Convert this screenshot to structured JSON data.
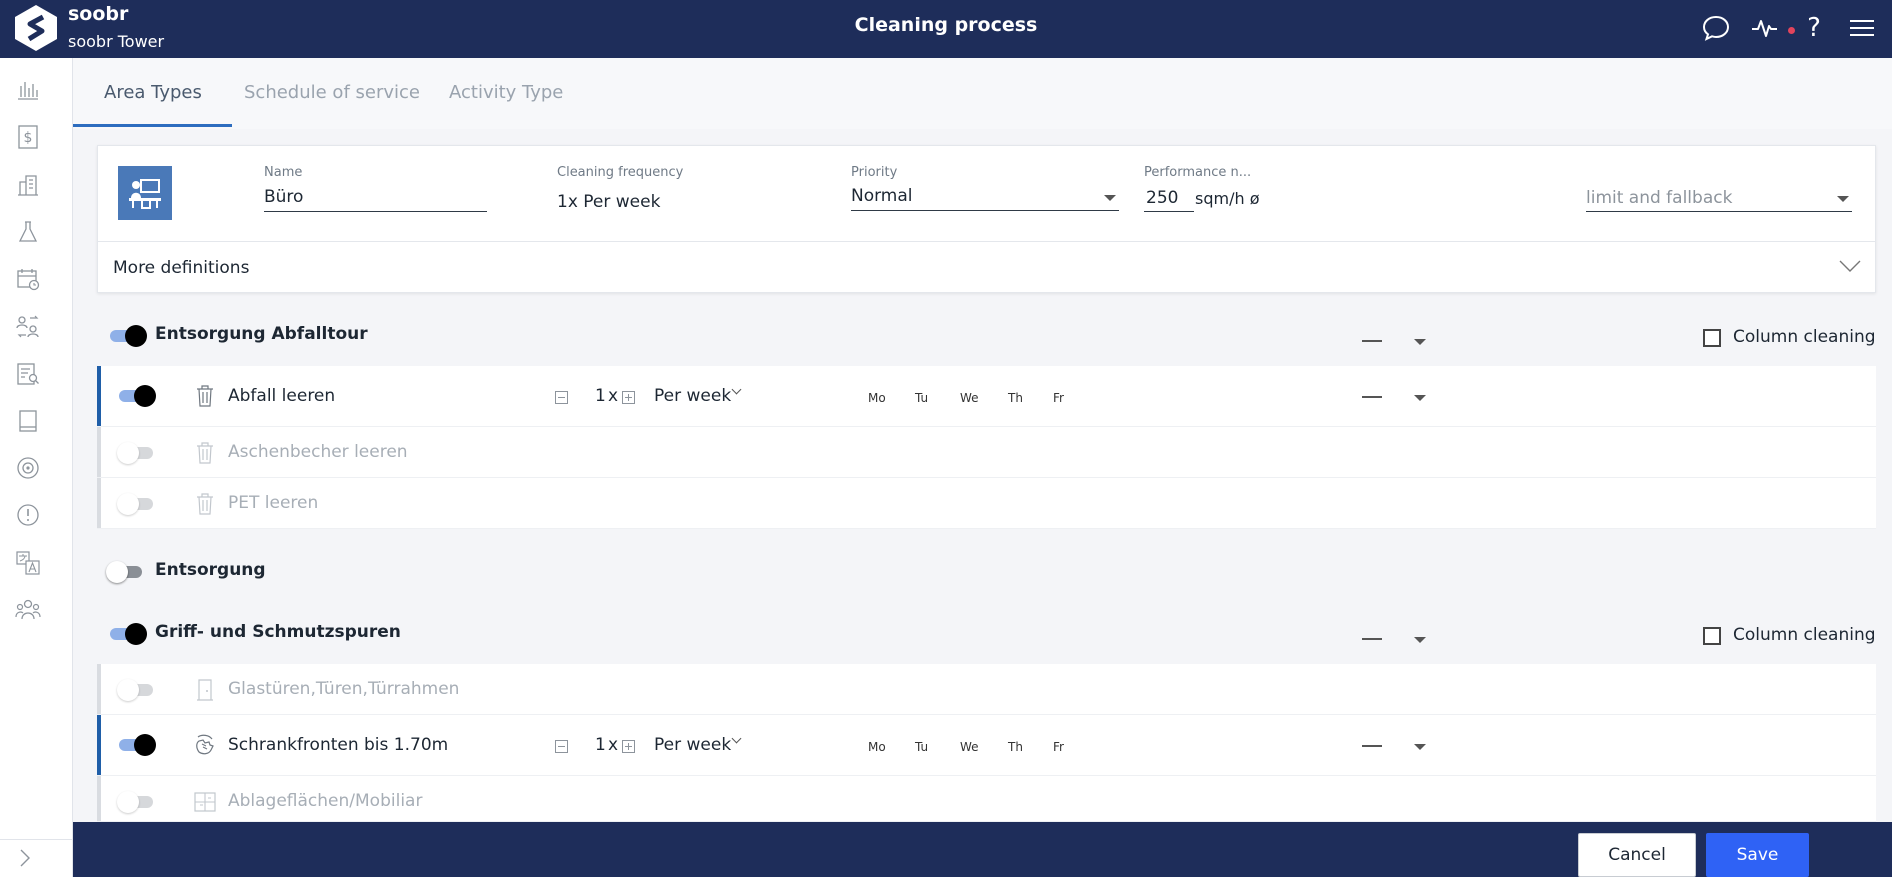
{
  "header": {
    "brand_name": "soobr",
    "site_name": "soobr Tower",
    "page_title": "Cleaning process",
    "icons": [
      "chat-icon",
      "activity-icon",
      "help-icon",
      "menu-icon"
    ],
    "help_glyph": "?"
  },
  "sidebar": {
    "items": [
      "bar-chart-icon",
      "dollar-icon",
      "building-icon",
      "flask-icon",
      "calendar-clock-icon",
      "swap-users-icon",
      "checklist-search-icon",
      "book-icon",
      "target-icon",
      "alert-icon",
      "translate-icon",
      "team-icon"
    ],
    "expand_icon": "chevron-right-icon"
  },
  "tabs": [
    {
      "label": "Area Types",
      "active": true
    },
    {
      "label": "Schedule of service",
      "active": false
    },
    {
      "label": "Activity Type",
      "active": false
    }
  ],
  "area": {
    "icon": "office-desk-icon",
    "name_label": "Name",
    "name_value": "Büro",
    "frequency_label": "Cleaning frequency",
    "frequency_value": "1x Per week",
    "priority_label": "Priority",
    "priority_value": "Normal",
    "performance_label": "Performance n...",
    "performance_value": "250",
    "performance_unit": "sqm/h ø",
    "limit_placeholder": "limit and fallback",
    "more_definitions": "More definitions"
  },
  "groups": [
    {
      "title": "Entsorgung Abfalltour",
      "enabled": true,
      "show_column_cleaning": true,
      "column_cleaning_label": "Column cleaning",
      "activities": [
        {
          "label": "Abfall leeren",
          "enabled": true,
          "icon": "trash-icon",
          "count": "1",
          "count_suffix": "x",
          "frequency": "Per week",
          "days": [
            "Mo",
            "Tu",
            "We",
            "Th",
            "Fr"
          ]
        },
        {
          "label": "Aschenbecher leeren",
          "enabled": false,
          "icon": "trash-icon"
        },
        {
          "label": "PET leeren",
          "enabled": false,
          "icon": "trash-icon"
        }
      ]
    },
    {
      "title": "Entsorgung",
      "enabled": false,
      "show_column_cleaning": false,
      "activities": []
    },
    {
      "title": "Griff- und Schmutzspuren",
      "enabled": true,
      "show_column_cleaning": true,
      "column_cleaning_label": "Column cleaning",
      "activities": [
        {
          "label": "Glastüren,Türen,Türrahmen",
          "enabled": false,
          "icon": "door-icon"
        },
        {
          "label": "Schrankfronten bis 1.70m",
          "enabled": true,
          "icon": "hand-wipe-icon",
          "count": "1",
          "count_suffix": "x",
          "frequency": "Per week",
          "days": [
            "Mo",
            "Tu",
            "We",
            "Th",
            "Fr"
          ]
        },
        {
          "label": "Ablageflächen/Mobiliar",
          "enabled": false,
          "icon": "shelf-icon"
        }
      ]
    }
  ],
  "footer": {
    "cancel_label": "Cancel",
    "save_label": "Save"
  },
  "colors": {
    "navy": "#1e2d5a",
    "accent": "#2f62f5",
    "active_row_bar": "#1f5ea8",
    "toggle_on_track": "#8fb0e8"
  }
}
